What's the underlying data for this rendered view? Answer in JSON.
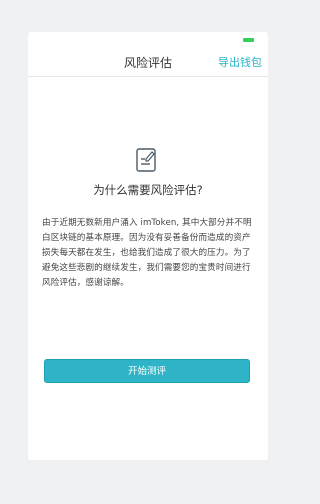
{
  "header": {
    "title": "风险评估",
    "export_wallet": "导出钱包"
  },
  "content": {
    "question": "为什么需要风险评估?",
    "description": "由于近期无数新用户涌入 imToken, 其中大部分并不明白区块链的基本原理。因为没有妥善备份而造成的资产损失每天都在发生，也给我们造成了很大的压力。为了避免这些悲剧的继续发生，我们需要您的宝贵时间进行风险评估，感谢谅解。"
  },
  "actions": {
    "start_label": "开始测评"
  },
  "colors": {
    "accent": "#2fb4c7",
    "status_indicator": "#2fd15a"
  },
  "icons": {
    "status": "battery-indicator-icon",
    "document": "document-edit-icon"
  }
}
